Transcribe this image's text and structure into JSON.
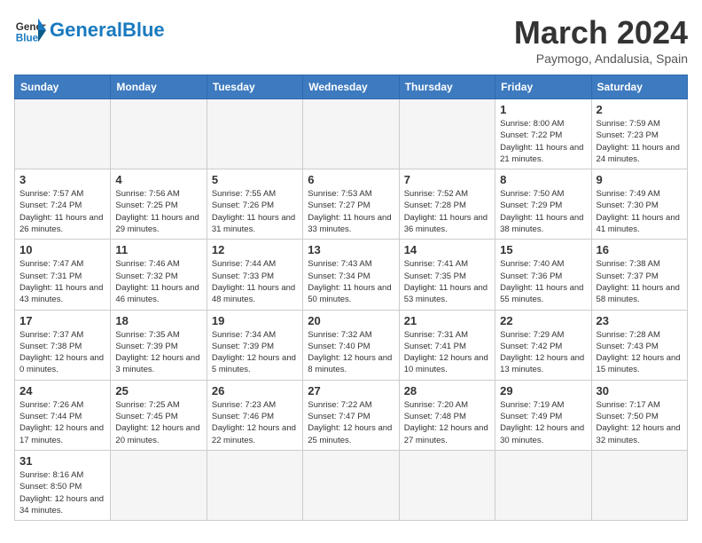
{
  "header": {
    "logo_general": "General",
    "logo_blue": "Blue",
    "month": "March 2024",
    "location": "Paymogo, Andalusia, Spain"
  },
  "days_of_week": [
    "Sunday",
    "Monday",
    "Tuesday",
    "Wednesday",
    "Thursday",
    "Friday",
    "Saturday"
  ],
  "weeks": [
    [
      {
        "day": "",
        "info": ""
      },
      {
        "day": "",
        "info": ""
      },
      {
        "day": "",
        "info": ""
      },
      {
        "day": "",
        "info": ""
      },
      {
        "day": "",
        "info": ""
      },
      {
        "day": "1",
        "info": "Sunrise: 8:00 AM\nSunset: 7:22 PM\nDaylight: 11 hours and 21 minutes."
      },
      {
        "day": "2",
        "info": "Sunrise: 7:59 AM\nSunset: 7:23 PM\nDaylight: 11 hours and 24 minutes."
      }
    ],
    [
      {
        "day": "3",
        "info": "Sunrise: 7:57 AM\nSunset: 7:24 PM\nDaylight: 11 hours and 26 minutes."
      },
      {
        "day": "4",
        "info": "Sunrise: 7:56 AM\nSunset: 7:25 PM\nDaylight: 11 hours and 29 minutes."
      },
      {
        "day": "5",
        "info": "Sunrise: 7:55 AM\nSunset: 7:26 PM\nDaylight: 11 hours and 31 minutes."
      },
      {
        "day": "6",
        "info": "Sunrise: 7:53 AM\nSunset: 7:27 PM\nDaylight: 11 hours and 33 minutes."
      },
      {
        "day": "7",
        "info": "Sunrise: 7:52 AM\nSunset: 7:28 PM\nDaylight: 11 hours and 36 minutes."
      },
      {
        "day": "8",
        "info": "Sunrise: 7:50 AM\nSunset: 7:29 PM\nDaylight: 11 hours and 38 minutes."
      },
      {
        "day": "9",
        "info": "Sunrise: 7:49 AM\nSunset: 7:30 PM\nDaylight: 11 hours and 41 minutes."
      }
    ],
    [
      {
        "day": "10",
        "info": "Sunrise: 7:47 AM\nSunset: 7:31 PM\nDaylight: 11 hours and 43 minutes."
      },
      {
        "day": "11",
        "info": "Sunrise: 7:46 AM\nSunset: 7:32 PM\nDaylight: 11 hours and 46 minutes."
      },
      {
        "day": "12",
        "info": "Sunrise: 7:44 AM\nSunset: 7:33 PM\nDaylight: 11 hours and 48 minutes."
      },
      {
        "day": "13",
        "info": "Sunrise: 7:43 AM\nSunset: 7:34 PM\nDaylight: 11 hours and 50 minutes."
      },
      {
        "day": "14",
        "info": "Sunrise: 7:41 AM\nSunset: 7:35 PM\nDaylight: 11 hours and 53 minutes."
      },
      {
        "day": "15",
        "info": "Sunrise: 7:40 AM\nSunset: 7:36 PM\nDaylight: 11 hours and 55 minutes."
      },
      {
        "day": "16",
        "info": "Sunrise: 7:38 AM\nSunset: 7:37 PM\nDaylight: 11 hours and 58 minutes."
      }
    ],
    [
      {
        "day": "17",
        "info": "Sunrise: 7:37 AM\nSunset: 7:38 PM\nDaylight: 12 hours and 0 minutes."
      },
      {
        "day": "18",
        "info": "Sunrise: 7:35 AM\nSunset: 7:39 PM\nDaylight: 12 hours and 3 minutes."
      },
      {
        "day": "19",
        "info": "Sunrise: 7:34 AM\nSunset: 7:39 PM\nDaylight: 12 hours and 5 minutes."
      },
      {
        "day": "20",
        "info": "Sunrise: 7:32 AM\nSunset: 7:40 PM\nDaylight: 12 hours and 8 minutes."
      },
      {
        "day": "21",
        "info": "Sunrise: 7:31 AM\nSunset: 7:41 PM\nDaylight: 12 hours and 10 minutes."
      },
      {
        "day": "22",
        "info": "Sunrise: 7:29 AM\nSunset: 7:42 PM\nDaylight: 12 hours and 13 minutes."
      },
      {
        "day": "23",
        "info": "Sunrise: 7:28 AM\nSunset: 7:43 PM\nDaylight: 12 hours and 15 minutes."
      }
    ],
    [
      {
        "day": "24",
        "info": "Sunrise: 7:26 AM\nSunset: 7:44 PM\nDaylight: 12 hours and 17 minutes."
      },
      {
        "day": "25",
        "info": "Sunrise: 7:25 AM\nSunset: 7:45 PM\nDaylight: 12 hours and 20 minutes."
      },
      {
        "day": "26",
        "info": "Sunrise: 7:23 AM\nSunset: 7:46 PM\nDaylight: 12 hours and 22 minutes."
      },
      {
        "day": "27",
        "info": "Sunrise: 7:22 AM\nSunset: 7:47 PM\nDaylight: 12 hours and 25 minutes."
      },
      {
        "day": "28",
        "info": "Sunrise: 7:20 AM\nSunset: 7:48 PM\nDaylight: 12 hours and 27 minutes."
      },
      {
        "day": "29",
        "info": "Sunrise: 7:19 AM\nSunset: 7:49 PM\nDaylight: 12 hours and 30 minutes."
      },
      {
        "day": "30",
        "info": "Sunrise: 7:17 AM\nSunset: 7:50 PM\nDaylight: 12 hours and 32 minutes."
      }
    ],
    [
      {
        "day": "31",
        "info": "Sunrise: 8:16 AM\nSunset: 8:50 PM\nDaylight: 12 hours and 34 minutes."
      },
      {
        "day": "",
        "info": ""
      },
      {
        "day": "",
        "info": ""
      },
      {
        "day": "",
        "info": ""
      },
      {
        "day": "",
        "info": ""
      },
      {
        "day": "",
        "info": ""
      },
      {
        "day": "",
        "info": ""
      }
    ]
  ]
}
